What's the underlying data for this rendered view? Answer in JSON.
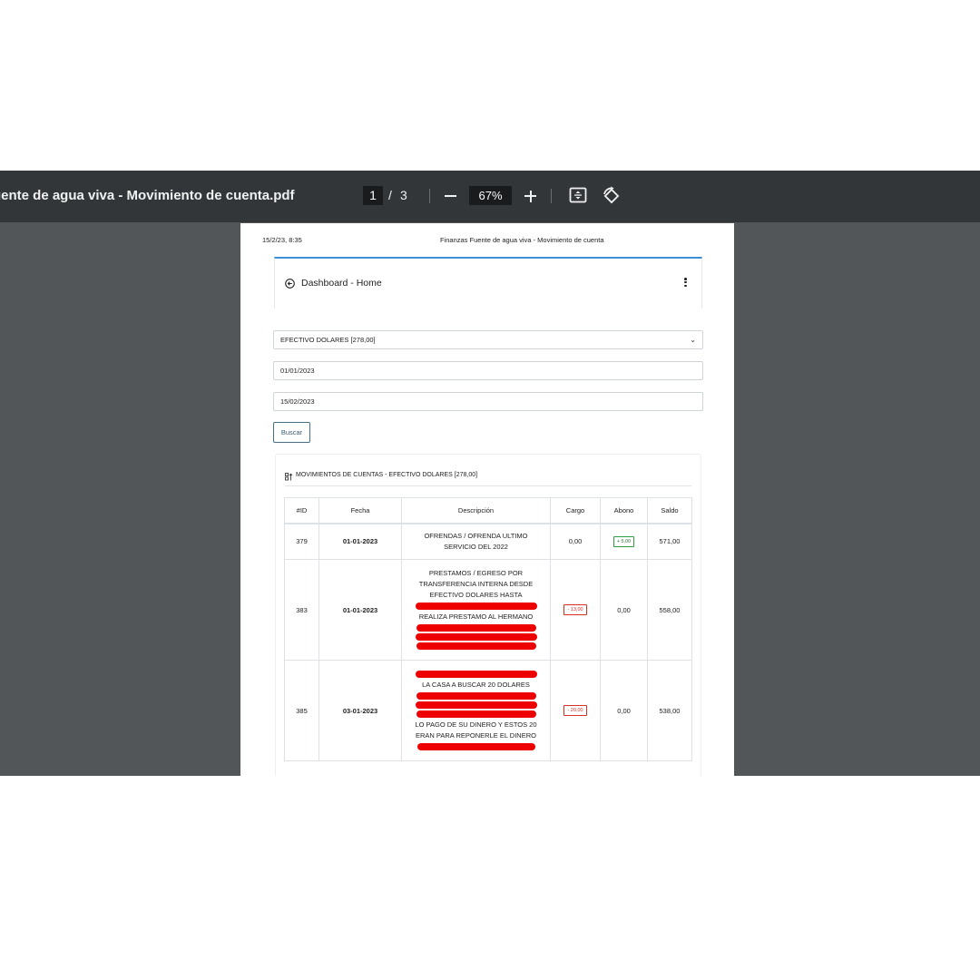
{
  "viewer": {
    "doc_title": "uente de agua viva - Movimiento de cuenta.pdf",
    "page_current": "1",
    "page_separator": "/",
    "page_total": "3",
    "zoom": "67%"
  },
  "page": {
    "print_date": "15/2/23, 8:35",
    "print_title": "Finanzas Fuente de agua viva - Movimiento de cuenta",
    "nav_title": "Dashboard - Home",
    "account_select": "EFECTIVO DOLARES [278,00]",
    "date_from": "01/01/2023",
    "date_to": "15/02/2023",
    "search_label": "Buscar",
    "movements_title": "MOVIMIENTOS DE CUENTAS - EFECTIVO DOLARES [278,00]",
    "table": {
      "headers": [
        "#ID",
        "Fecha",
        "Descripción",
        "Cargo",
        "Abono",
        "Saldo"
      ],
      "rows": [
        {
          "id": "379",
          "fecha": "01-01-2023",
          "desc_lines": [
            "OFRENDAS / OFRENDA ULTIMO",
            "SERVICIO DEL 2022"
          ],
          "cargo": "0,00",
          "abono": "+ 5,00",
          "saldo": "571,00"
        },
        {
          "id": "383",
          "fecha": "01-01-2023",
          "desc_lines": [
            "PRESTAMOS / EGRESO POR",
            "TRANSFERENCIA INTERNA DESDE",
            "EFECTIVO DOLARES HASTA",
            "REALIZA PRESTAMO AL HERMANO"
          ],
          "cargo": "- 13,00",
          "abono": "0,00",
          "saldo": "558,00"
        },
        {
          "id": "385",
          "fecha": "03-01-2023",
          "desc_lines": [
            "LA CASA A BUSCAR 20 DOLARES",
            "LO PAGO DE SU DINERO Y ESTOS 20",
            "ERAN PARA REPONERLE EL DINERO"
          ],
          "cargo": "- 20,00",
          "abono": "0,00",
          "saldo": "538,00"
        }
      ]
    }
  },
  "colors": {
    "toolbar_bg": "#323639",
    "viewer_bg": "#525659",
    "accent_blue": "#3a8fd6",
    "redaction": "#ee0000",
    "badge_red": "#d93025",
    "badge_green": "#2e9e44"
  }
}
